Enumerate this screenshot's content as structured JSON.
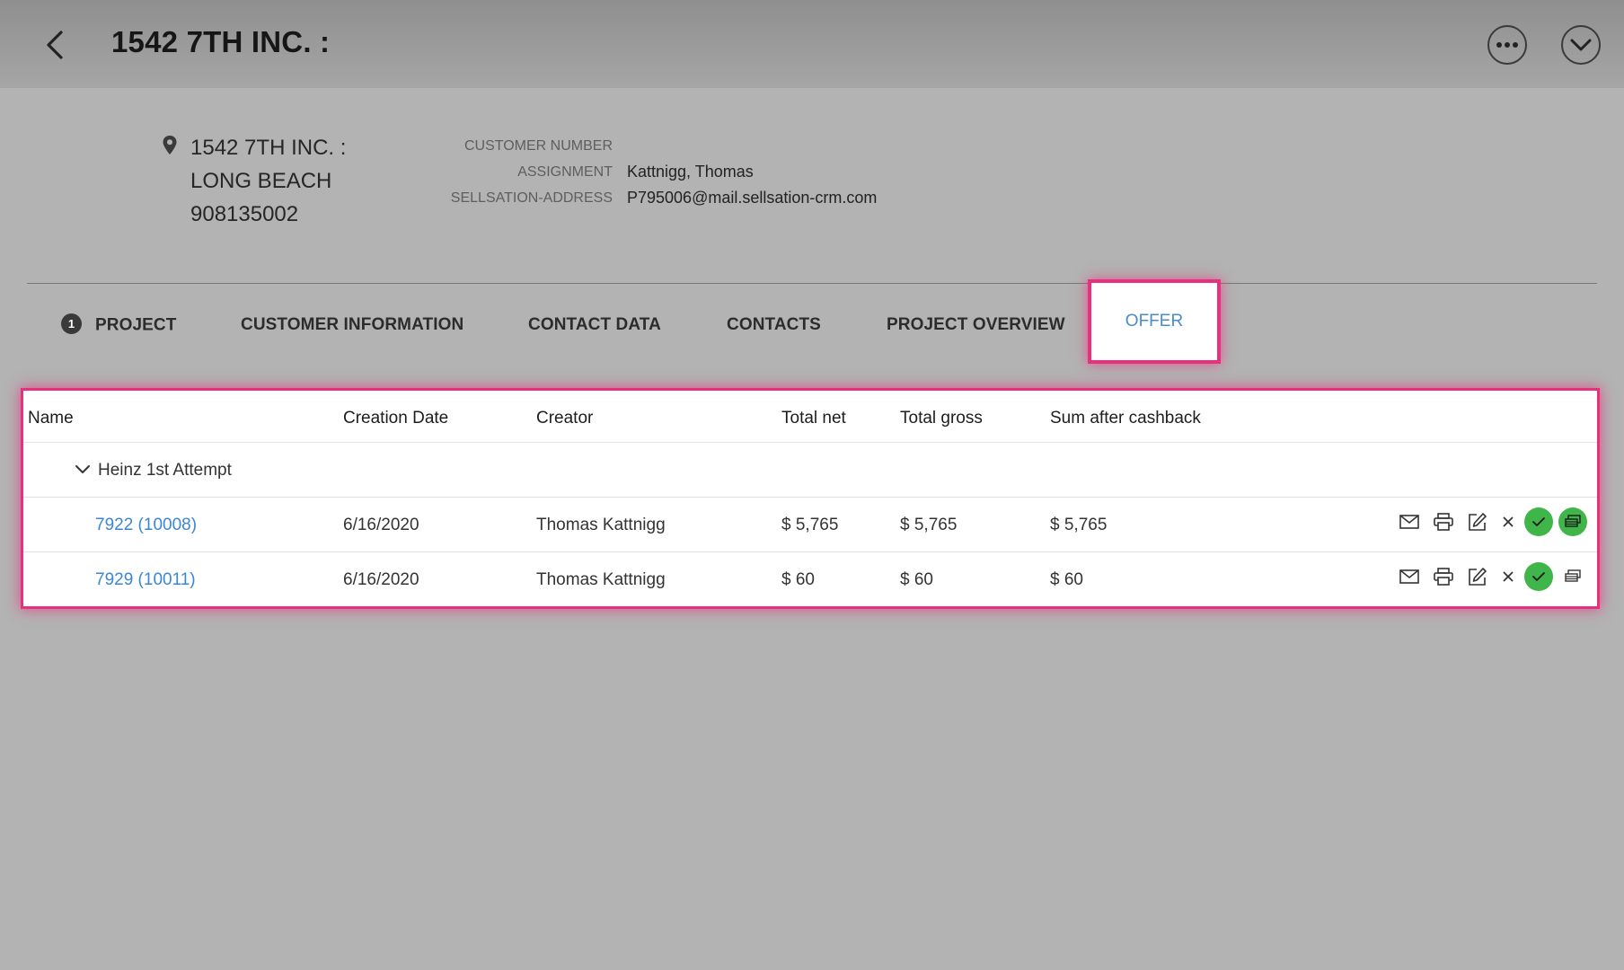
{
  "header": {
    "title": "1542 7TH INC. :"
  },
  "address": {
    "lines": [
      "1542 7TH INC. :",
      "LONG BEACH",
      "908135002"
    ]
  },
  "info": {
    "customer_number_label": "CUSTOMER NUMBER",
    "customer_number_value": "",
    "assignment_label": "ASSIGNMENT",
    "assignment_value": "Kattnigg, Thomas",
    "sellsation_label": "SELLSATION-ADDRESS",
    "sellsation_value": "P795006@mail.sellsation-crm.com"
  },
  "tabs": {
    "project_badge": "1",
    "project": "PROJECT",
    "customer_information": "CUSTOMER INFORMATION",
    "contact_data": "CONTACT DATA",
    "contacts": "CONTACTS",
    "project_overview": "PROJECT OVERVIEW",
    "offer": "OFFER"
  },
  "table": {
    "columns": [
      "Name",
      "Creation Date",
      "Creator",
      "Total net",
      "Total gross",
      "Sum after cashback"
    ],
    "group": "Heinz 1st Attempt",
    "rows": [
      {
        "name": "7922 (10008)",
        "date": "6/16/2020",
        "creator": "Thomas Kattnigg",
        "net": "$ 5,765",
        "gross": "$ 5,765",
        "cashback": "$ 5,765"
      },
      {
        "name": "7929 (10011)",
        "date": "6/16/2020",
        "creator": "Thomas Kattnigg",
        "net": "$ 60",
        "gross": "$ 60",
        "cashback": "$ 60"
      }
    ]
  },
  "colors": {
    "accent": "#e8307f",
    "link": "#3b86d6",
    "success": "#3fb54a"
  },
  "icons": [
    "chevron-left-icon",
    "more-dots-icon",
    "chevron-down-icon",
    "location-pin-icon",
    "mail-icon",
    "print-icon",
    "edit-icon",
    "close-icon",
    "check-icon",
    "stack-icon"
  ]
}
